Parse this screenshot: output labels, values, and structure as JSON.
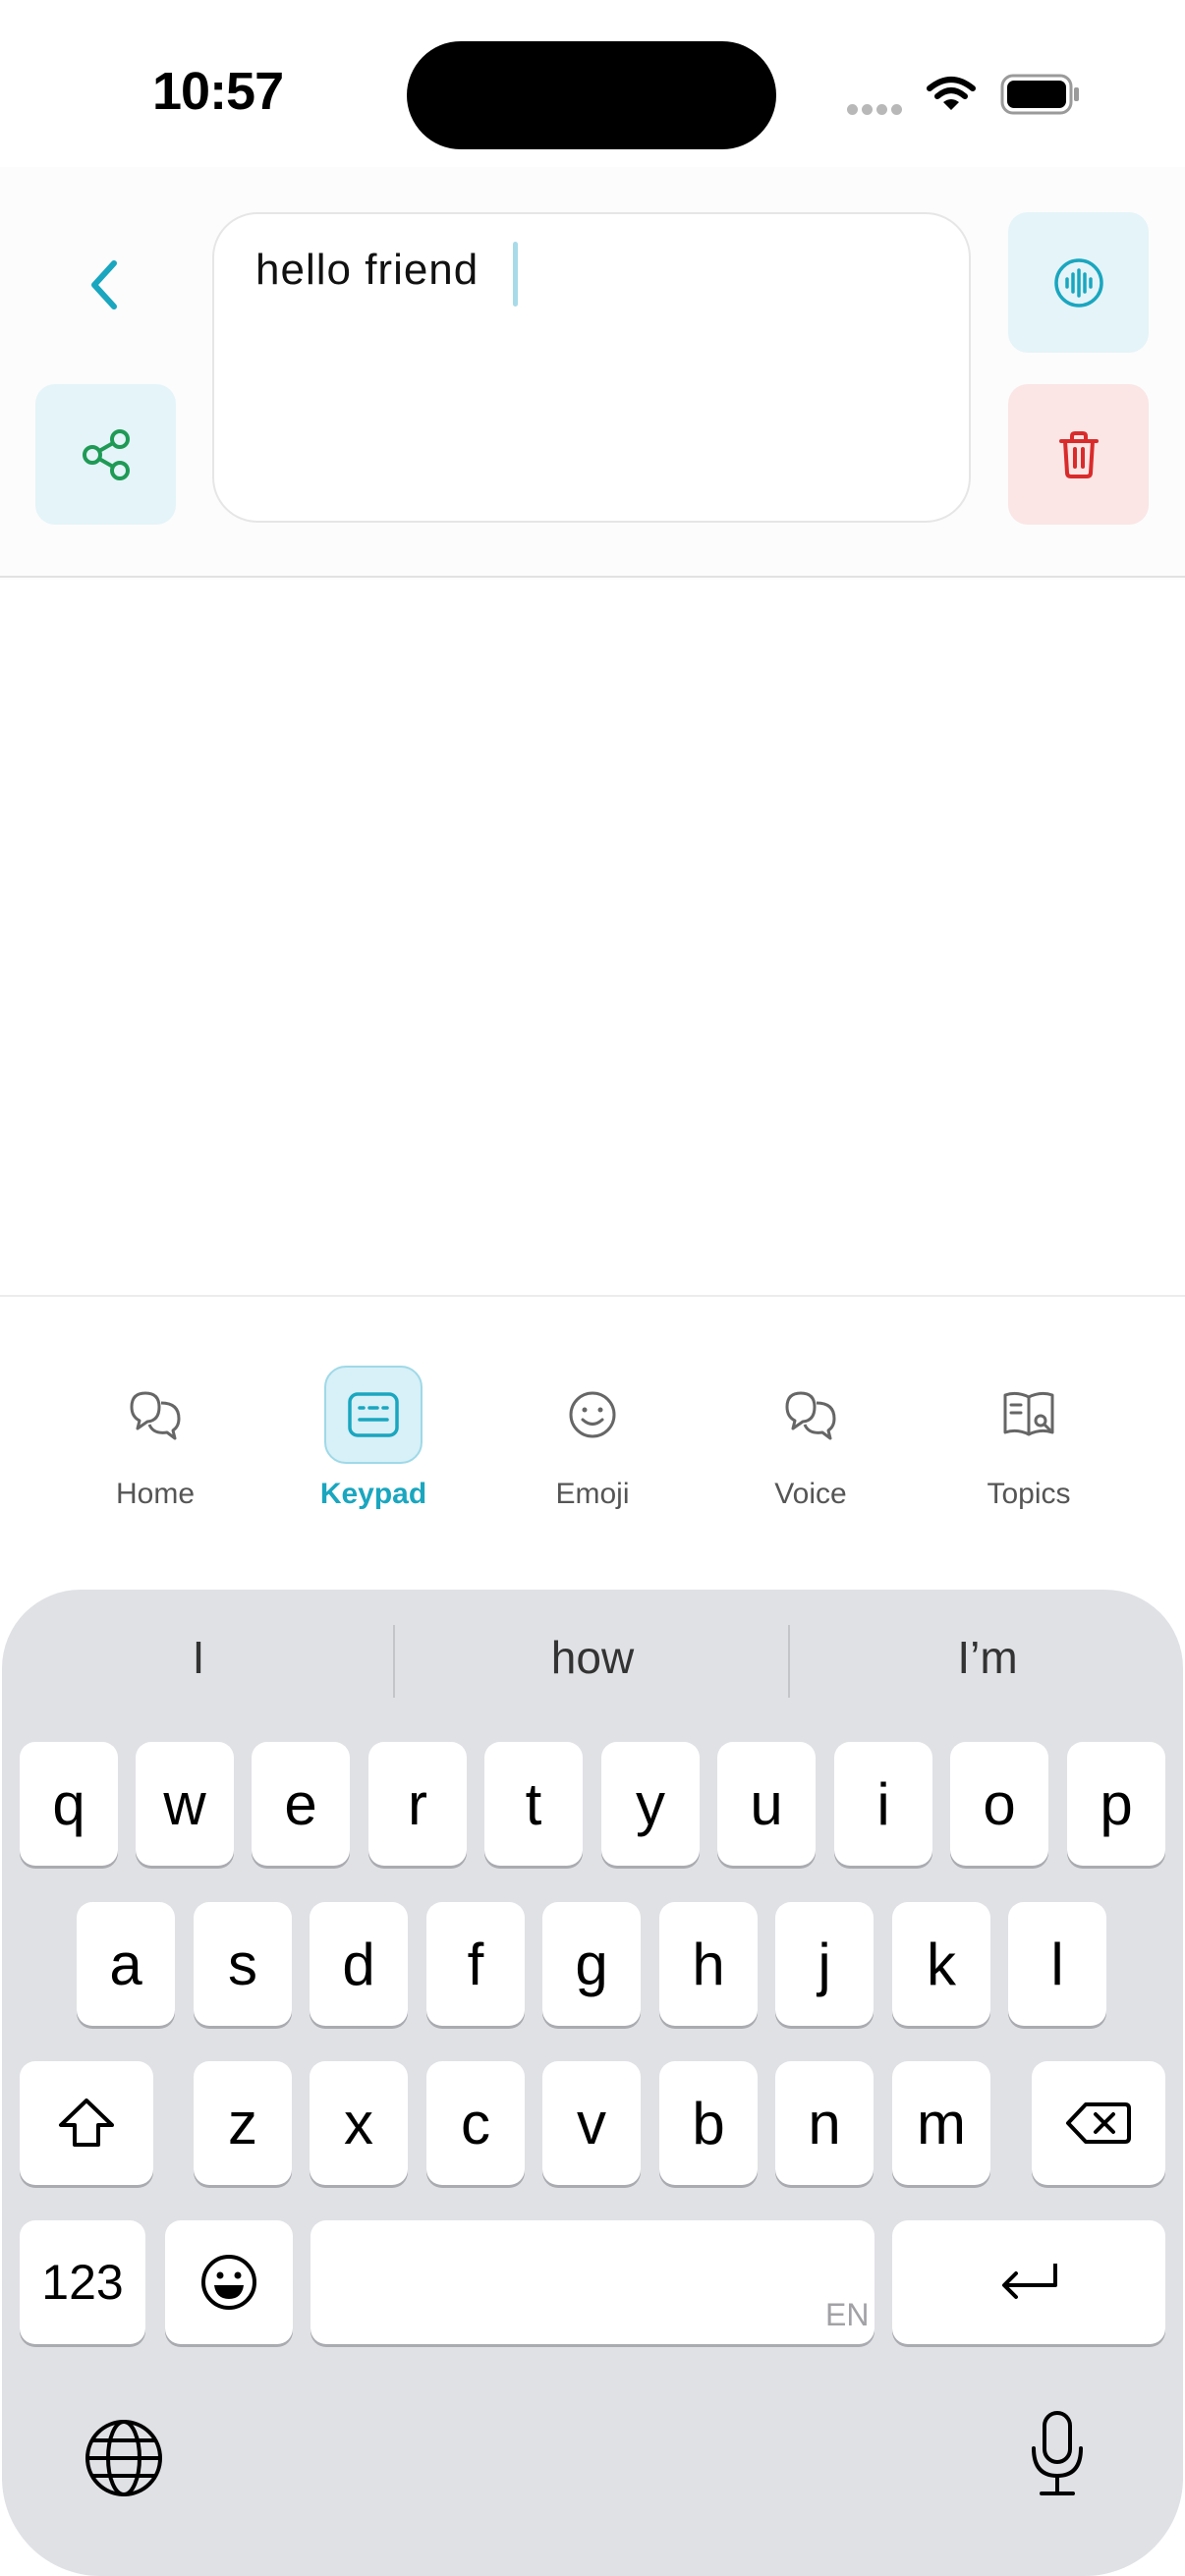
{
  "status_bar": {
    "time": "10:57"
  },
  "compose": {
    "text": "hello friend"
  },
  "nav": {
    "items": [
      {
        "label": "Home",
        "icon": "chat-bubbles-icon"
      },
      {
        "label": "Keypad",
        "icon": "keypad-icon",
        "active": true
      },
      {
        "label": "Emoji",
        "icon": "smiley-icon"
      },
      {
        "label": "Voice",
        "icon": "chat-bubbles-icon"
      },
      {
        "label": "Topics",
        "icon": "book-search-icon"
      }
    ]
  },
  "keyboard": {
    "suggestions": [
      "I",
      "how",
      "I’m"
    ],
    "row1": [
      "q",
      "w",
      "e",
      "r",
      "t",
      "y",
      "u",
      "i",
      "o",
      "p"
    ],
    "row2": [
      "a",
      "s",
      "d",
      "f",
      "g",
      "h",
      "j",
      "k",
      "l"
    ],
    "row3": [
      "z",
      "x",
      "c",
      "v",
      "b",
      "n",
      "m"
    ],
    "numbers_label": "123",
    "language": "EN"
  },
  "colors": {
    "accent": "#1aa6bf",
    "share_green": "#1f9a55",
    "delete_red": "#d92b2b",
    "keyboard_bg": "#e0e1e5"
  }
}
